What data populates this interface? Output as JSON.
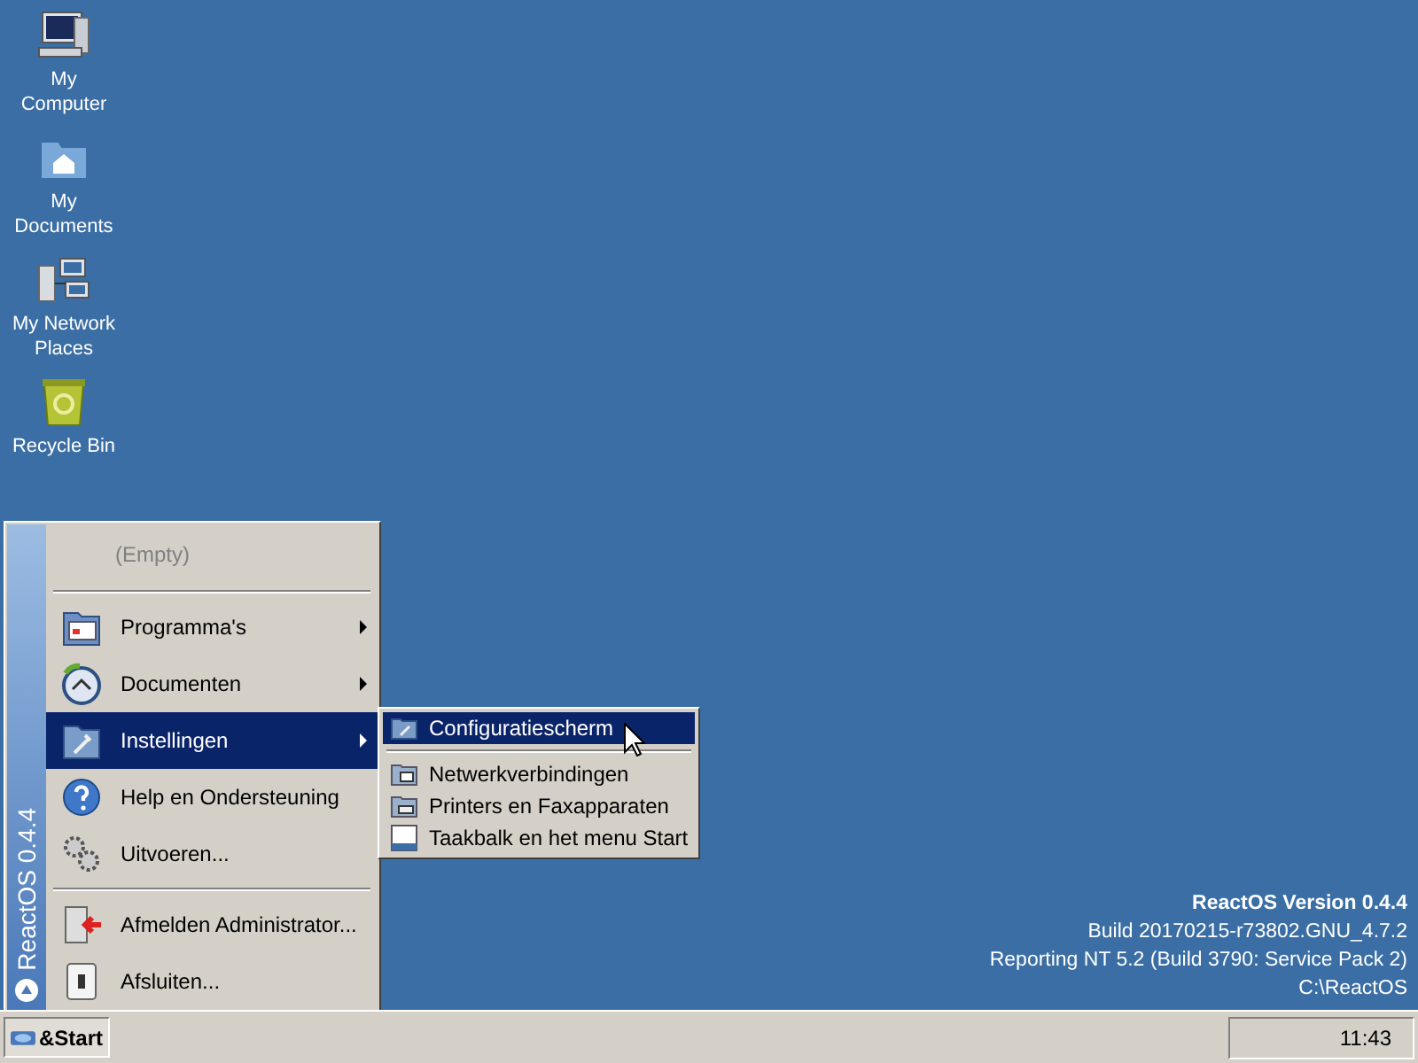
{
  "desktop_icons": [
    {
      "kind": "computer",
      "label": "My Computer"
    },
    {
      "kind": "documents",
      "label": "My Documents"
    },
    {
      "kind": "network",
      "label": "My Network Places"
    },
    {
      "kind": "recycle",
      "label": "Recycle Bin"
    }
  ],
  "version_info": {
    "title": "ReactOS Version 0.4.4",
    "lines": [
      "Build 20170215-r73802.GNU_4.7.2",
      "Reporting NT 5.2 (Build 3790: Service Pack 2)",
      "C:\\ReactOS"
    ]
  },
  "start_menu": {
    "banner": "ReactOS 0.4.4",
    "items": [
      {
        "kind": "empty",
        "label": "(Empty)"
      },
      {
        "kind": "separator"
      },
      {
        "kind": "programs",
        "label": "Programma's",
        "submenu": true,
        "selected": false
      },
      {
        "kind": "documents",
        "label": "Documenten",
        "submenu": true,
        "selected": false
      },
      {
        "kind": "settings",
        "label": "Instellingen",
        "submenu": true,
        "selected": true
      },
      {
        "kind": "help",
        "label": "Help en Ondersteuning",
        "submenu": false,
        "selected": false
      },
      {
        "kind": "run",
        "label": "Uitvoeren...",
        "submenu": false,
        "selected": false
      },
      {
        "kind": "separator"
      },
      {
        "kind": "logoff",
        "label": "Afmelden Administrator...",
        "submenu": false,
        "selected": false
      },
      {
        "kind": "shutdown",
        "label": "Afsluiten...",
        "submenu": false,
        "selected": false
      }
    ]
  },
  "submenu": {
    "items": [
      {
        "kind": "control",
        "label": "Configuratiescherm",
        "selected": true
      },
      {
        "kind": "separator"
      },
      {
        "kind": "network",
        "label": "Netwerkverbindingen",
        "selected": false
      },
      {
        "kind": "printers",
        "label": "Printers en Faxapparaten",
        "selected": false
      },
      {
        "kind": "taskbar",
        "label": "Taakbalk en het menu Start",
        "selected": false
      }
    ]
  },
  "taskbar": {
    "start_label": "&Start",
    "clock": "11:43"
  }
}
